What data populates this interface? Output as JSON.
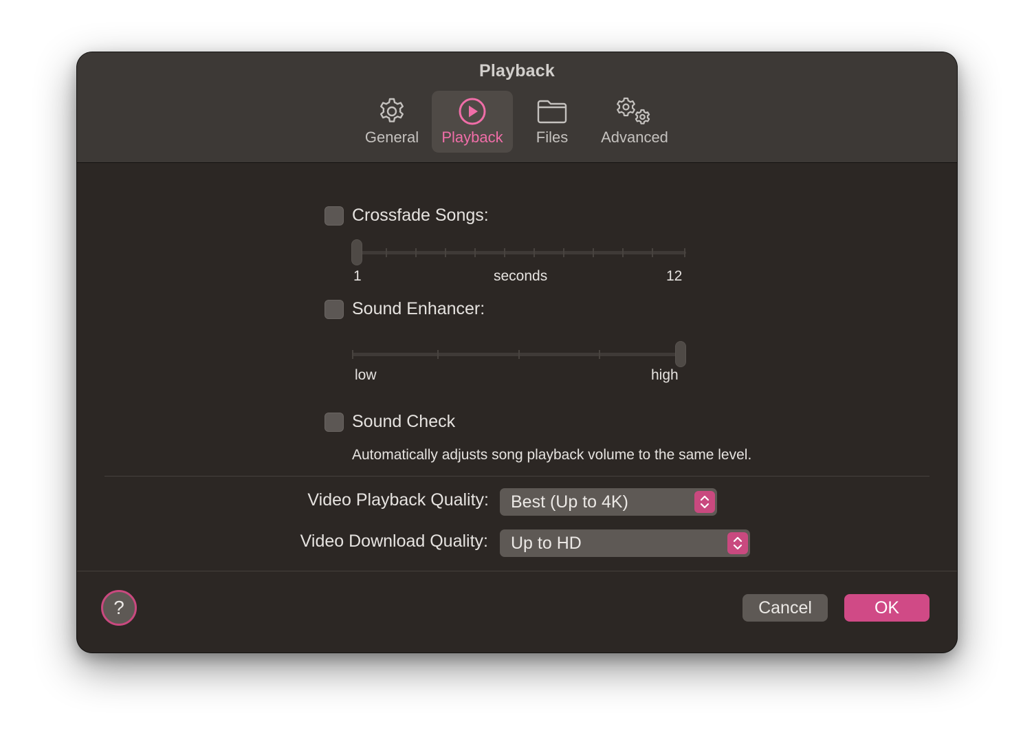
{
  "window": {
    "title": "Playback"
  },
  "tabs": [
    {
      "label": "General",
      "icon": "gear-icon",
      "active": false
    },
    {
      "label": "Playback",
      "icon": "play-circle-icon",
      "active": true
    },
    {
      "label": "Files",
      "icon": "folder-icon",
      "active": false
    },
    {
      "label": "Advanced",
      "icon": "gears-icon",
      "active": false
    }
  ],
  "crossfade": {
    "label": "Crossfade Songs:",
    "checked": false,
    "min_label": "1",
    "unit_label": "seconds",
    "max_label": "12",
    "value": 1,
    "min": 1,
    "max": 12
  },
  "sound_enhancer": {
    "label": "Sound Enhancer:",
    "checked": false,
    "low_label": "low",
    "high_label": "high",
    "value_fraction": 1.0
  },
  "sound_check": {
    "label": "Sound Check",
    "checked": false,
    "description": "Automatically adjusts song playback volume to the same level."
  },
  "video_playback": {
    "label": "Video Playback Quality:",
    "value": "Best (Up to 4K)"
  },
  "video_download": {
    "label": "Video Download Quality:",
    "value": "Up to HD"
  },
  "buttons": {
    "help": "?",
    "cancel": "Cancel",
    "ok": "OK"
  },
  "colors": {
    "accent": "#d04a86",
    "accent_text": "#f06ea8",
    "background": "#2c2724",
    "titlebar": "#3d3936"
  }
}
